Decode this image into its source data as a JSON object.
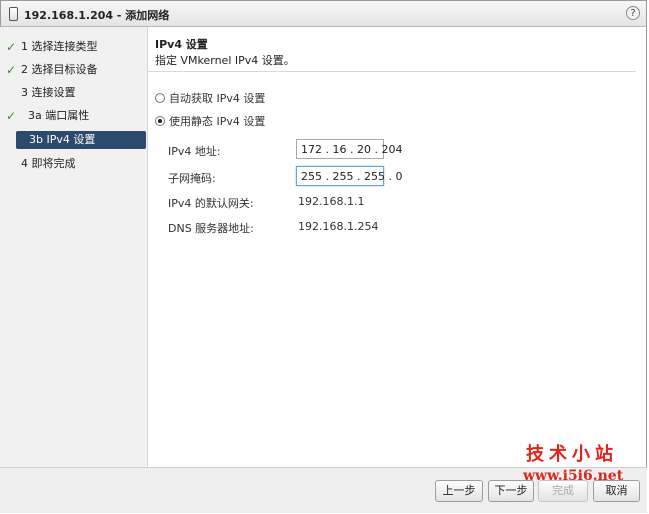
{
  "window": {
    "title": "192.168.1.204 - 添加网络",
    "help_glyph": "?"
  },
  "sidebar": {
    "steps": [
      {
        "label": "1  选择连接类型",
        "completed": true
      },
      {
        "label": "2  选择目标设备",
        "completed": true
      },
      {
        "label": "3  连接设置",
        "completed": false
      },
      {
        "label": "3a  端口属性",
        "completed": true
      },
      {
        "label": "3b  IPv4 设置",
        "completed": false,
        "active": true
      },
      {
        "label": "4  即将完成",
        "completed": false
      }
    ],
    "check_glyph": "✓"
  },
  "main": {
    "title": "IPv4 设置",
    "description": "指定 VMkernel IPv4 设置。",
    "options": [
      {
        "label": "自动获取 IPv4 设置",
        "selected": false
      },
      {
        "label": "使用静态 IPv4 设置",
        "selected": true
      }
    ],
    "fields": {
      "ipv4_address": {
        "label": "IPv4 地址:",
        "value": "172 . 16 . 20 . 204"
      },
      "subnet_mask": {
        "label": "子网掩码:",
        "value": "255 . 255 . 255 . 0"
      },
      "gateway": {
        "label": "IPv4 的默认网关:",
        "value": "192.168.1.1"
      },
      "dns": {
        "label": "DNS 服务器地址:",
        "value": "192.168.1.254"
      }
    }
  },
  "footer": {
    "back": "上一步",
    "next": "下一步",
    "finish": "完成",
    "cancel": "取消"
  },
  "watermark": {
    "line1": "技术小站",
    "line2": "www.i5i6.net"
  },
  "colors": {
    "active_step_bg": "#2c4a6e",
    "check": "#3a8f2a",
    "watermark": "#e0241c"
  }
}
